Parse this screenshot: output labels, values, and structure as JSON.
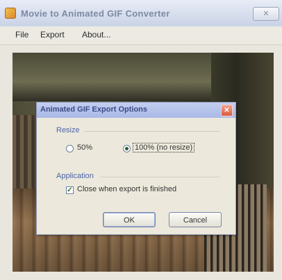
{
  "window": {
    "title": "Movie to Animated GIF Converter",
    "close_glyph": "✕"
  },
  "menu": {
    "items": [
      "File",
      "Export",
      "About..."
    ]
  },
  "dialog": {
    "title": "Animated GIF Export Options",
    "close_glyph": "✕",
    "resize": {
      "group_label": "Resize",
      "options": [
        "50%",
        "100% (no resize)"
      ],
      "selected": "100% (no resize)"
    },
    "application": {
      "group_label": "Application",
      "checkbox_label": "Close when export is finished",
      "checked": true
    },
    "buttons": {
      "ok": "OK",
      "cancel": "Cancel"
    }
  }
}
